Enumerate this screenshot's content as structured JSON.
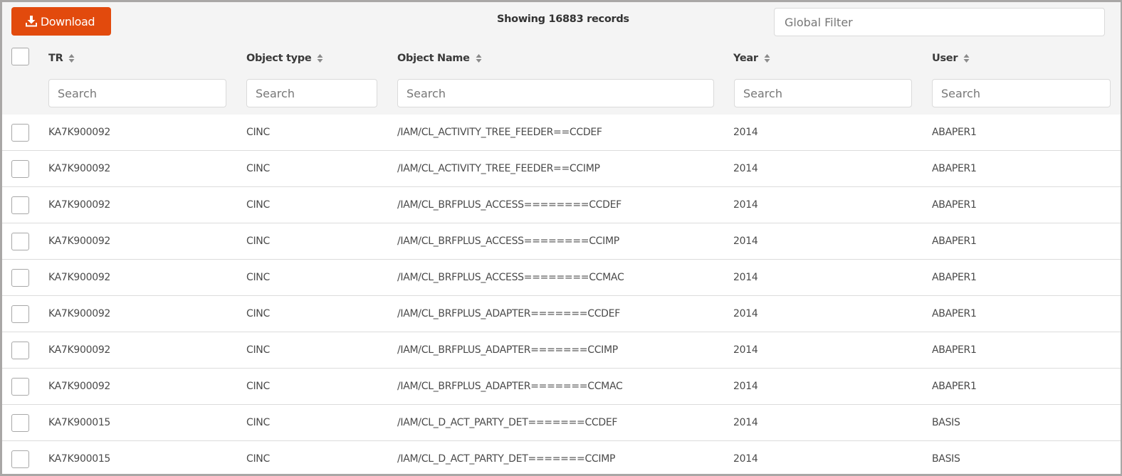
{
  "toolbar": {
    "download_label": "Download",
    "download_icon": "download-icon",
    "record_count_text": "Showing 16883 records",
    "global_filter_placeholder": "Global Filter",
    "global_filter_value": ""
  },
  "colors": {
    "accent": "#e24a0d",
    "header_bg": "#f4f4f4",
    "row_border": "#dcdcdc"
  },
  "table": {
    "columns": [
      {
        "key": "tr",
        "label": "TR",
        "sort_icon": "sort-icon",
        "filter_placeholder": "Search"
      },
      {
        "key": "object_type",
        "label": "Object type",
        "sort_icon": "sort-icon",
        "filter_placeholder": "Search"
      },
      {
        "key": "object_name",
        "label": "Object Name",
        "sort_icon": "sort-icon",
        "filter_placeholder": "Search"
      },
      {
        "key": "year",
        "label": "Year",
        "sort_icon": "sort-icon",
        "filter_placeholder": "Search"
      },
      {
        "key": "user",
        "label": "User",
        "sort_icon": "sort-icon",
        "filter_placeholder": "Search"
      }
    ],
    "rows": [
      {
        "tr": "KA7K900092",
        "object_type": "CINC",
        "object_name": "/IAM/CL_ACTIVITY_TREE_FEEDER==CCDEF",
        "year": "2014",
        "user": "ABAPER1",
        "selected": false
      },
      {
        "tr": "KA7K900092",
        "object_type": "CINC",
        "object_name": "/IAM/CL_ACTIVITY_TREE_FEEDER==CCIMP",
        "year": "2014",
        "user": "ABAPER1",
        "selected": false
      },
      {
        "tr": "KA7K900092",
        "object_type": "CINC",
        "object_name": "/IAM/CL_BRFPLUS_ACCESS========CCDEF",
        "year": "2014",
        "user": "ABAPER1",
        "selected": false
      },
      {
        "tr": "KA7K900092",
        "object_type": "CINC",
        "object_name": "/IAM/CL_BRFPLUS_ACCESS========CCIMP",
        "year": "2014",
        "user": "ABAPER1",
        "selected": false
      },
      {
        "tr": "KA7K900092",
        "object_type": "CINC",
        "object_name": "/IAM/CL_BRFPLUS_ACCESS========CCMAC",
        "year": "2014",
        "user": "ABAPER1",
        "selected": false
      },
      {
        "tr": "KA7K900092",
        "object_type": "CINC",
        "object_name": "/IAM/CL_BRFPLUS_ADAPTER=======CCDEF",
        "year": "2014",
        "user": "ABAPER1",
        "selected": false
      },
      {
        "tr": "KA7K900092",
        "object_type": "CINC",
        "object_name": "/IAM/CL_BRFPLUS_ADAPTER=======CCIMP",
        "year": "2014",
        "user": "ABAPER1",
        "selected": false
      },
      {
        "tr": "KA7K900092",
        "object_type": "CINC",
        "object_name": "/IAM/CL_BRFPLUS_ADAPTER=======CCMAC",
        "year": "2014",
        "user": "ABAPER1",
        "selected": false
      },
      {
        "tr": "KA7K900015",
        "object_type": "CINC",
        "object_name": "/IAM/CL_D_ACT_PARTY_DET=======CCDEF",
        "year": "2014",
        "user": "BASIS",
        "selected": false
      },
      {
        "tr": "KA7K900015",
        "object_type": "CINC",
        "object_name": "/IAM/CL_D_ACT_PARTY_DET=======CCIMP",
        "year": "2014",
        "user": "BASIS",
        "selected": false
      }
    ]
  }
}
